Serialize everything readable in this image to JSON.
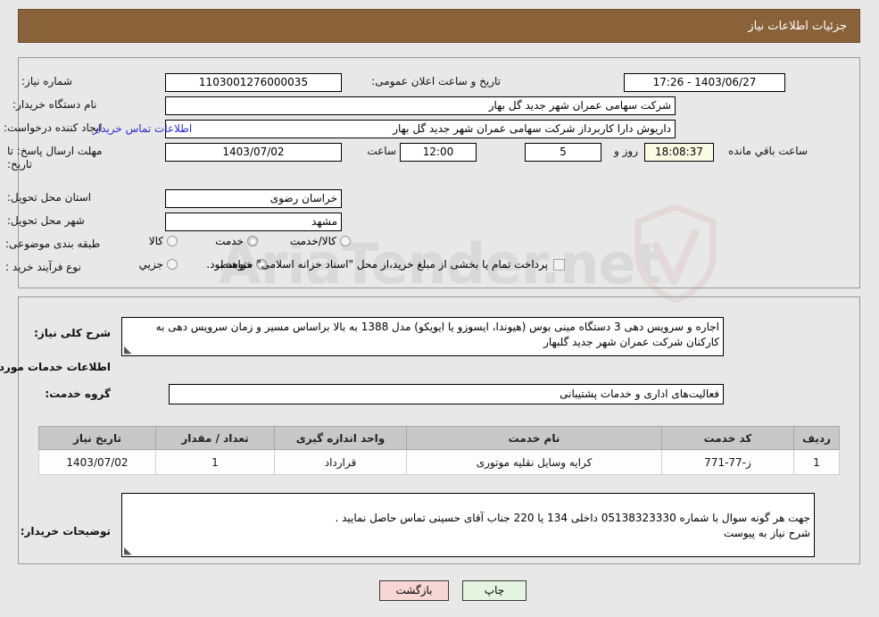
{
  "header": {
    "title": "جزئیات اطلاعات نیاز",
    "bar_color": "#8a6239"
  },
  "watermark": {
    "text": "AriaTender.net"
  },
  "form": {
    "need_number_label": "شماره نیاز:",
    "need_number_value": "1103001276000035",
    "public_announce_label": "تاریخ و ساعت اعلان عمومی:",
    "public_announce_value": "1403/06/27 - 17:26",
    "buyer_org_label": "نام دستگاه خریدار:",
    "buyer_org_value": "شرکت سهامی عمران شهر جدید گل بهار",
    "requester_label": "ایجاد کننده درخواست:",
    "requester_value": "داریوش دارا کاربرداز شرکت سهامی عمران شهر جدید گل بهار",
    "buyer_contact_link": "اطلاعات تماس خریدار",
    "deadline_label": "مهلت ارسال پاسخ: تا تاریخ:",
    "deadline_date": "1403/07/02",
    "hour_label": "ساعت",
    "deadline_time": "12:00",
    "days_value": "5",
    "days_label": "روز و",
    "remaining_value": "18:08:37",
    "remaining_label": "ساعت باقي مانده",
    "province_label": "استان محل تحویل:",
    "province_value": "خراسان رضوی",
    "city_label": "شهر محل تحویل:",
    "city_value": "مشهد",
    "category_label": "طبقه بندی موضوعی:",
    "category_options": [
      {
        "label": "کالا",
        "selected": false
      },
      {
        "label": "خدمت",
        "selected": true
      },
      {
        "label": "کالا/خدمت",
        "selected": false
      }
    ],
    "process_label": "نوع فرآیند خرید :",
    "process_options": [
      {
        "label": "جزیي",
        "selected": false
      },
      {
        "label": "متوسط",
        "selected": true
      }
    ],
    "treasury_checkbox_label": "پرداخت تمام یا بخشی از مبلغ خرید،از محل \"اسناد خزانه اسلامی\" خواهد بود.",
    "treasury_checked": false
  },
  "details": {
    "general_desc_label": "شرح کلی نیاز:",
    "general_desc_value": "اجاره و سرویس دهی 3 دستگاه مینی بوس (هیوندا، ایسوزو یا ایویکو) مدل 1388 به بالا براساس مسیر و زمان سرویس دهی به کارکنان شرکت عمران شهر جدید گلبهار",
    "services_section_title": "اطلاعات خدمات مورد نیاز",
    "service_group_label": "گروه خدمت:",
    "service_group_value": "فعالیت‌های اداری و خدمات پشتیبانی",
    "buyer_notes_label": "توضیحات خریدار:",
    "buyer_notes_value": "جهت هر گونه سوال با شماره 05138323330 داخلی 134 یا 220 جناب آقای حسینی تماس حاصل نمایید .\nشرح نیاز به پیوست"
  },
  "table": {
    "columns": [
      "ردیف",
      "کد خدمت",
      "نام خدمت",
      "واحد اندازه گیری",
      "تعداد / مقدار",
      "تاریخ نیاز"
    ],
    "rows": [
      {
        "index": "1",
        "code": "ز-77-771",
        "name": "کرایه وسایل نقلیه موتوری",
        "unit": "قرارداد",
        "qty": "1",
        "date": "1403/07/02"
      }
    ]
  },
  "footer": {
    "print_label": "چاپ",
    "back_label": "بازگشت"
  }
}
